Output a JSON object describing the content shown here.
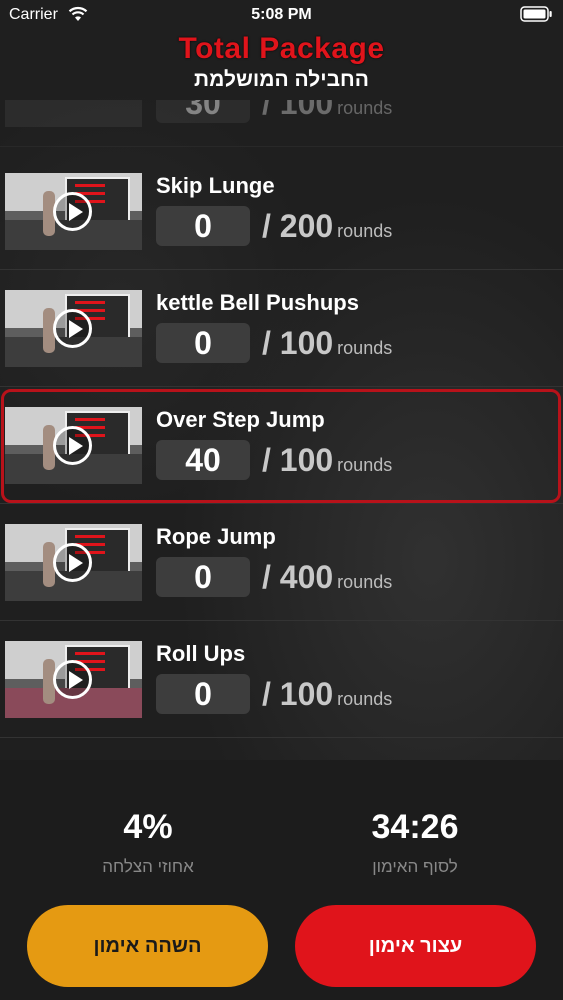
{
  "status_bar": {
    "carrier": "Carrier",
    "time": "5:08 PM"
  },
  "header": {
    "title_en": "Total Package",
    "title_he": "החבילה המושלמת"
  },
  "exercises": [
    {
      "name": "Skip Lunge",
      "count": "0",
      "total": "/ 200",
      "unit": "rounds"
    },
    {
      "name": "kettle Bell Pushups",
      "count": "0",
      "total": "/ 100",
      "unit": "rounds"
    },
    {
      "name": "Over Step Jump",
      "count": "40",
      "total": "/ 100",
      "unit": "rounds",
      "active": true
    },
    {
      "name": "Rope Jump",
      "count": "0",
      "total": "/ 400",
      "unit": "rounds"
    },
    {
      "name": "Roll Ups",
      "count": "0",
      "total": "/ 100",
      "unit": "rounds"
    }
  ],
  "partial_rows": {
    "top": {
      "count": "30",
      "total": "/ 100",
      "unit": "rounds"
    }
  },
  "stats": {
    "success_value": "4%",
    "success_label": "אחוזי הצלחה",
    "time_value": "34:26",
    "time_label": "לסוף האימון"
  },
  "buttons": {
    "pause_label": "השהה אימון",
    "stop_label": "עצור אימון"
  },
  "colors": {
    "accent": "#e0141b",
    "pause": "#e59a12",
    "background": "#1f1f1f"
  },
  "icons": [
    "wifi-icon",
    "battery-icon",
    "play-icon"
  ]
}
